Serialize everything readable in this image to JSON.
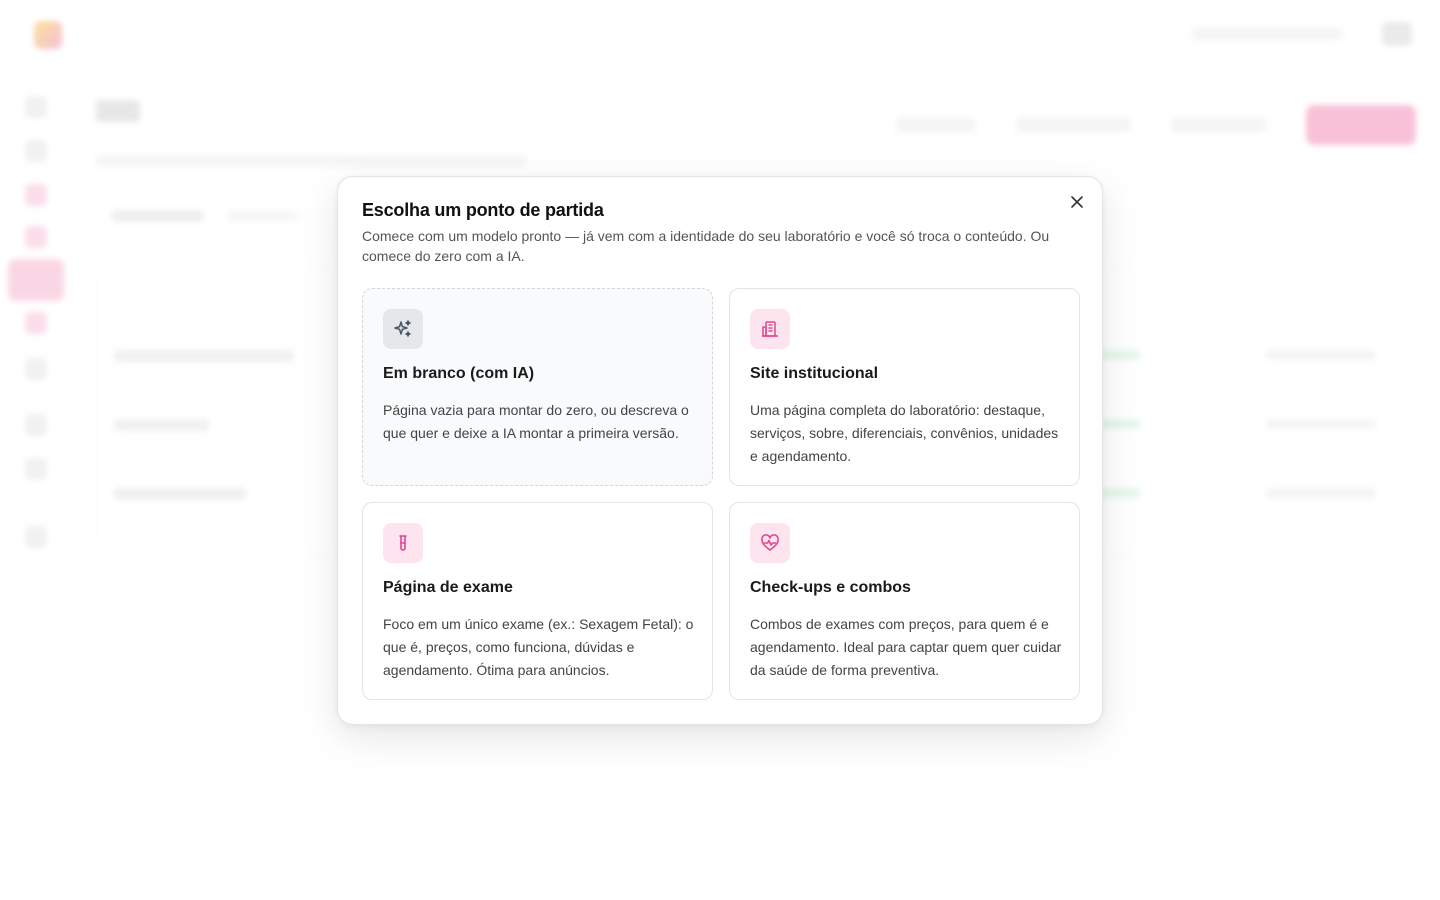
{
  "modal": {
    "title": "Escolha um ponto de partida",
    "description": "Comece com um modelo pronto — já vem com a identidade do seu laboratório e você só troca o conteúdo. Ou comece do zero com a IA.",
    "cards": [
      {
        "title": "Em branco (com IA)",
        "description": "Página vazia para montar do zero, ou descreva o que quer e deixe a IA montar a primeira versão.",
        "icon": "sparkles-icon"
      },
      {
        "title": "Site institucional",
        "description": "Uma página completa do laboratório: destaque, serviços, sobre, diferenciais, convênios, unidades e agendamento.",
        "icon": "building-icon"
      },
      {
        "title": "Página de exame",
        "description": "Foco em um único exame (ex.: Sexagem Fetal): o que é, preços, como funciona, dúvidas e agendamento. Ótima para anúncios.",
        "icon": "test-tube-icon"
      },
      {
        "title": "Check-ups e combos",
        "description": "Combos de exames com preços, para quem é e agendamento. Ideal para captar quem quer cuidar da saúde de forma preventiva.",
        "icon": "heart-pulse-icon"
      }
    ]
  },
  "colors": {
    "accent": "#e0478f",
    "accent_bg": "#fde4ef",
    "neutral_icon_bg": "#e5e7eb"
  }
}
